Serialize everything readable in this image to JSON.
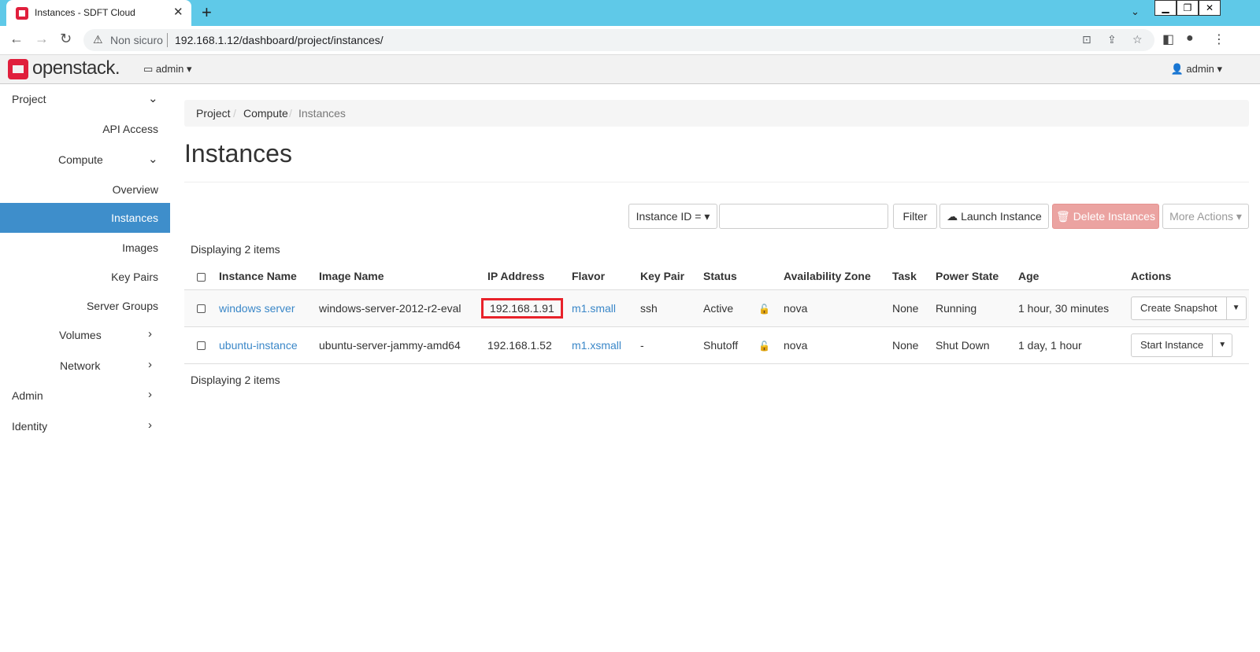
{
  "browser": {
    "tab_title": "Instances - SDFT Cloud",
    "security_label": "Non sicuro",
    "url": "192.168.1.12/dashboard/project/instances/"
  },
  "header": {
    "logo_text": "openstack.",
    "project_switch": "admin",
    "user_menu": "admin"
  },
  "sidebar": {
    "items": [
      {
        "label": "Project"
      },
      {
        "label": "API Access"
      },
      {
        "label": "Compute"
      },
      {
        "label": "Overview"
      },
      {
        "label": "Instances"
      },
      {
        "label": "Images"
      },
      {
        "label": "Key Pairs"
      },
      {
        "label": "Server Groups"
      },
      {
        "label": "Volumes"
      },
      {
        "label": "Network"
      },
      {
        "label": "Admin"
      },
      {
        "label": "Identity"
      }
    ]
  },
  "breadcrumb": [
    "Project",
    "Compute",
    "Instances"
  ],
  "page": {
    "title": "Instances",
    "count_top": "Displaying 2 items",
    "count_bottom": "Displaying 2 items"
  },
  "toolbar": {
    "filter_field": "Instance ID =",
    "filter_value": "",
    "filter_button": "Filter",
    "launch_button": "Launch Instance",
    "delete_button": "Delete Instances",
    "more_button": "More Actions"
  },
  "table": {
    "headers": [
      "Instance Name",
      "Image Name",
      "IP Address",
      "Flavor",
      "Key Pair",
      "Status",
      "Availability Zone",
      "Task",
      "Power State",
      "Age",
      "Actions"
    ],
    "rows": [
      {
        "name": "windows server",
        "image": "windows-server-2012-r2-eval",
        "ip": "192.168.1.91",
        "flavor": "m1.small",
        "keypair": "ssh",
        "status": "Active",
        "zone": "nova",
        "task": "None",
        "power": "Running",
        "age": "1 hour, 30 minutes",
        "action": "Create Snapshot"
      },
      {
        "name": "ubuntu-instance",
        "image": "ubuntu-server-jammy-amd64",
        "ip": "192.168.1.52",
        "flavor": "m1.xsmall",
        "keypair": "-",
        "status": "Shutoff",
        "zone": "nova",
        "task": "None",
        "power": "Shut Down",
        "age": "1 day, 1 hour",
        "action": "Start Instance"
      }
    ]
  },
  "colors": {
    "browser_tabbar": "#5fc9e8",
    "sidebar_active": "#3e8ecb",
    "link": "#3a87c8",
    "danger_button": "#eba3a1",
    "highlight_box": "#e8222a",
    "logo_red": "#e01f3c"
  }
}
